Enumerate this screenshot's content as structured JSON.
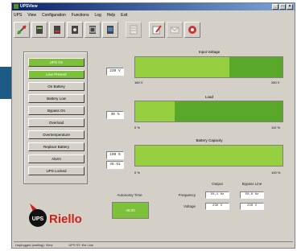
{
  "window": {
    "title": "UPSView",
    "minimize": "_",
    "maximize": "□",
    "close": "×"
  },
  "menu": [
    "UPS",
    "View",
    "Configuration",
    "Functions",
    "Log",
    "Help",
    "Exit"
  ],
  "toolbar_icons": [
    "connect-icon",
    "ups-status-icon",
    "ups-log-icon",
    "ups-config-icon",
    "ups-schedule-icon",
    "ups-monitor-icon",
    "page-icon",
    "settings-pen-icon",
    "mail-icon",
    "help-icon"
  ],
  "sidebar": {
    "items": [
      {
        "label": "UPS On",
        "active": true
      },
      {
        "label": "Line Present",
        "active": true
      },
      {
        "label": "On Battery",
        "active": false
      },
      {
        "label": "Battery Low",
        "active": false
      },
      {
        "label": "Bypass On",
        "active": false
      },
      {
        "label": "Overload",
        "active": false
      },
      {
        "label": "Overtemperature",
        "active": false
      },
      {
        "label": "Replace Battery",
        "active": false
      },
      {
        "label": "Alarm",
        "active": false
      },
      {
        "label": "UPS Locked",
        "active": false
      }
    ]
  },
  "input_voltage": {
    "label": "Input Voltage",
    "value": "230 V",
    "min": "160 V",
    "max": "260 V",
    "fill_fraction": 0.64
  },
  "load": {
    "label": "Load",
    "value": "30 %",
    "min": "0 %",
    "max": "110 %",
    "fill_fraction": 0.27
  },
  "battery": {
    "label": "Battery Capacity",
    "value": "100 %",
    "value2": "45:51",
    "min": "0 %",
    "max": "100 %",
    "fill_fraction": 1.0
  },
  "autonomy": {
    "label": "Autonomy Time",
    "value": "45:00"
  },
  "table": {
    "col_output": "Output",
    "col_bypass": "Bypass Line",
    "row_frequency": "Frequency",
    "row_voltage": "Voltage",
    "freq_output": "50,1 Hz",
    "freq_bypass": "50,0 Hz",
    "volt_output": "230 V",
    "volt_bypass": "230 V"
  },
  "logo": {
    "text": "Riello",
    "badge": "UPS"
  },
  "status": {
    "left": "Unplugged (waiting): View",
    "right": "UPS ST: Ext Line"
  },
  "colors": {
    "active_green": "#7dc03a",
    "bar_dark": "#5aa82a",
    "bar_light": "#96d040",
    "logo_red": "#d0201a"
  }
}
